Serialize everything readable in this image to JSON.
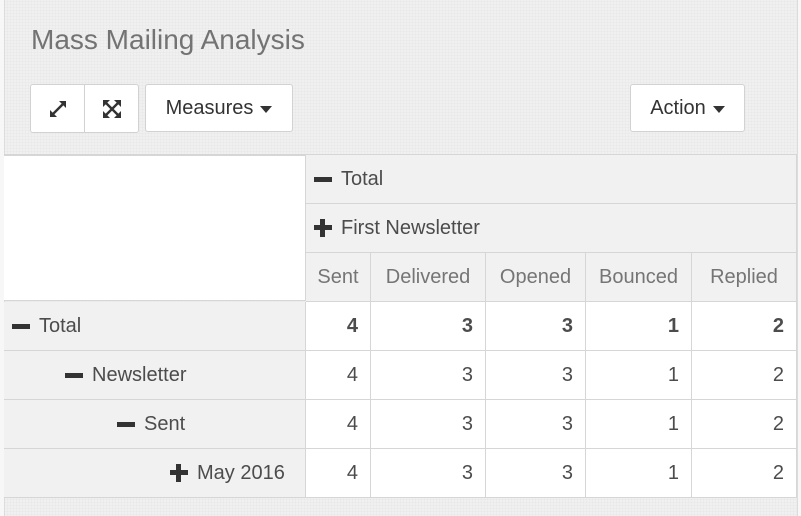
{
  "page": {
    "title": "Mass Mailing Analysis"
  },
  "toolbar": {
    "expand_icon": "expand-arrows-icon",
    "fullscreen_icon": "fullscreen-icon",
    "measures_label": "Measures",
    "action_label": "Action"
  },
  "pivot": {
    "col_header_total": "Total",
    "col_header_group": "First Newsletter",
    "measures": [
      "Sent",
      "Delivered",
      "Opened",
      "Bounced",
      "Replied"
    ],
    "rows": [
      {
        "label": "Total",
        "toggle": "minus",
        "values": [
          "4",
          "3",
          "3",
          "1",
          "2"
        ]
      },
      {
        "label": "Newsletter",
        "toggle": "minus",
        "values": [
          "4",
          "3",
          "3",
          "1",
          "2"
        ]
      },
      {
        "label": "Sent",
        "toggle": "minus",
        "values": [
          "4",
          "3",
          "3",
          "1",
          "2"
        ]
      },
      {
        "label": "May 2016",
        "toggle": "plus",
        "values": [
          "4",
          "3",
          "3",
          "1",
          "2"
        ]
      }
    ]
  },
  "colors": {
    "text": "#4c4c4c",
    "title": "#737373",
    "border": "#d6d6d6"
  }
}
